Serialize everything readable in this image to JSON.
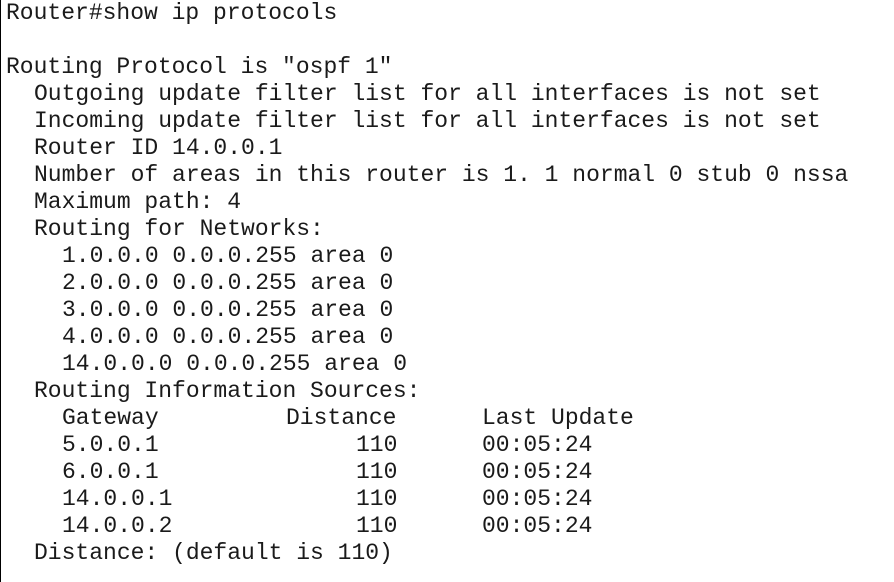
{
  "terminal": {
    "command_line": "Router#show ip protocols",
    "routing_protocol_line": "Routing Protocol is \"ospf 1\"",
    "outgoing_filter": "Outgoing update filter list for all interfaces is not set",
    "incoming_filter": "Incoming update filter list for all interfaces is not set",
    "router_id": "Router ID 14.0.0.1",
    "areas": "Number of areas in this router is 1. 1 normal 0 stub 0 nssa",
    "max_path": "Maximum path: 4",
    "networks_header": "Routing for Networks:",
    "networks": [
      "1.0.0.0 0.0.0.255 area 0",
      "2.0.0.0 0.0.0.255 area 0",
      "3.0.0.0 0.0.0.255 area 0",
      "4.0.0.0 0.0.0.255 area 0",
      "14.0.0.0 0.0.0.255 area 0"
    ],
    "sources_header": "Routing Information Sources:",
    "sources_columns": {
      "gateway": "Gateway",
      "distance": "Distance",
      "last_update": "Last Update"
    },
    "sources": [
      {
        "gateway": "5.0.0.1",
        "distance": "110",
        "last_update": "00:05:24"
      },
      {
        "gateway": "6.0.0.1",
        "distance": "110",
        "last_update": "00:05:24"
      },
      {
        "gateway": "14.0.0.1",
        "distance": "110",
        "last_update": "00:05:24"
      },
      {
        "gateway": "14.0.0.2",
        "distance": "110",
        "last_update": "00:05:24"
      }
    ],
    "distance_line": "Distance: (default is 110)"
  }
}
